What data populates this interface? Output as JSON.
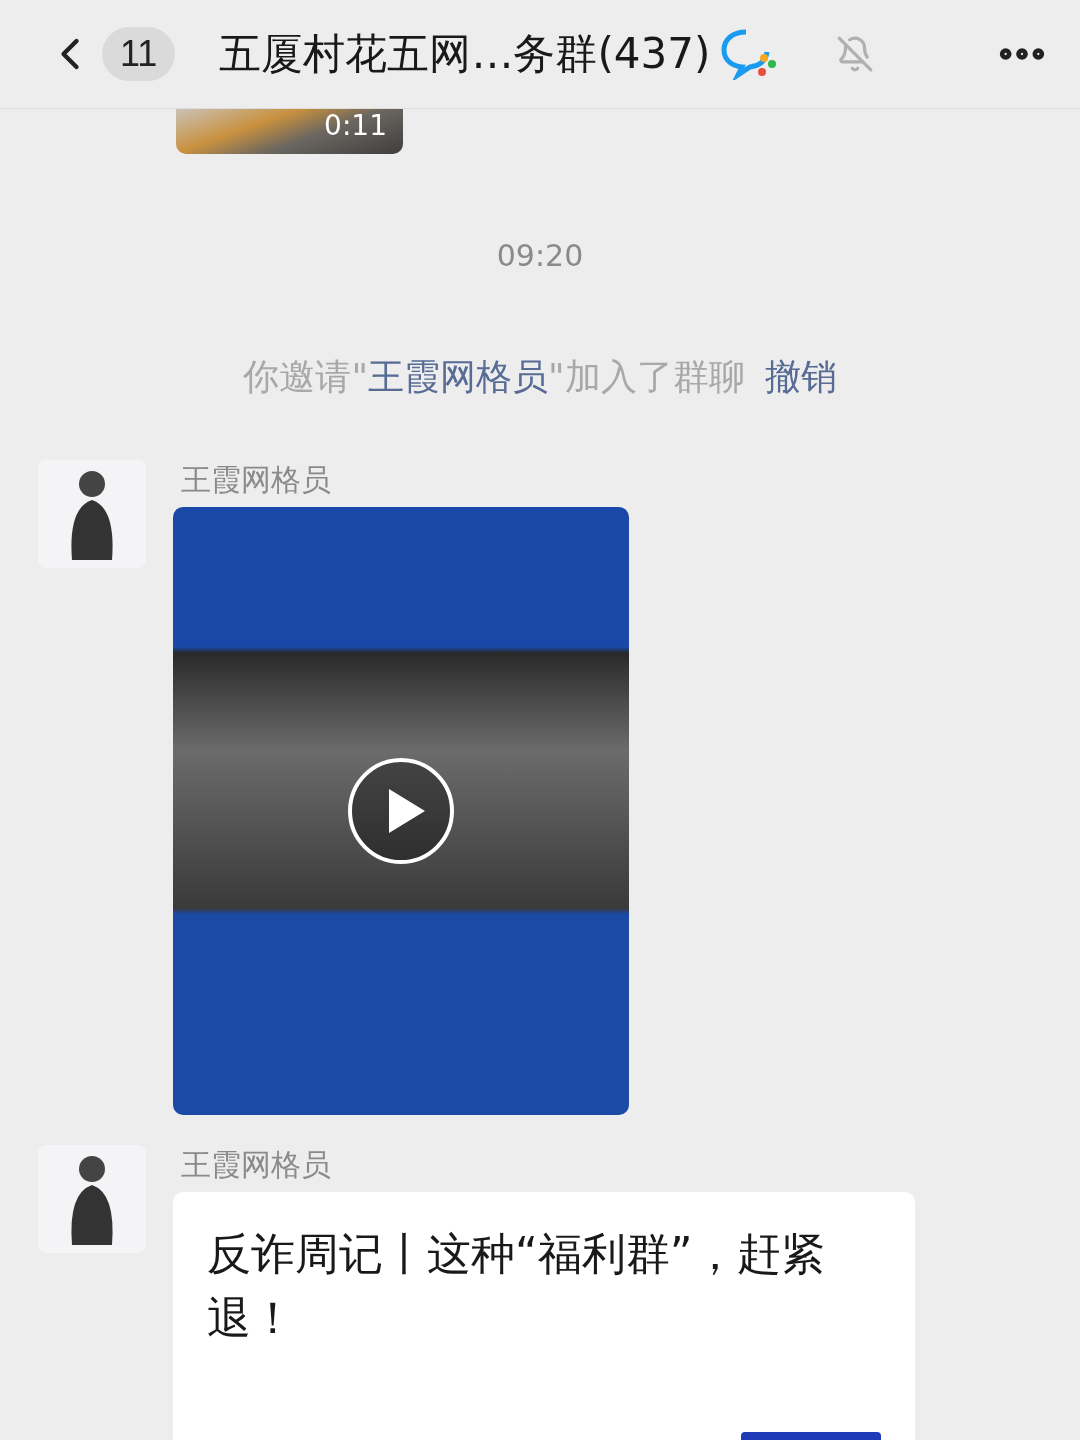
{
  "header": {
    "back_count": "11",
    "title": "五厦村花五网…务群(437)",
    "muted": true
  },
  "messages": [
    {
      "kind": "video_clip",
      "duration": "0:11"
    },
    {
      "kind": "time",
      "text": "09:20"
    },
    {
      "kind": "system",
      "before": "你邀请\"",
      "name": "王霞网格员",
      "after": "\"加入了群聊",
      "action": "撤销"
    },
    {
      "kind": "video_card",
      "sender": "王霞网格员"
    },
    {
      "kind": "link",
      "sender": "王霞网格员",
      "title": "反诈周记丨这种“福利群”，赶紧退！"
    }
  ]
}
